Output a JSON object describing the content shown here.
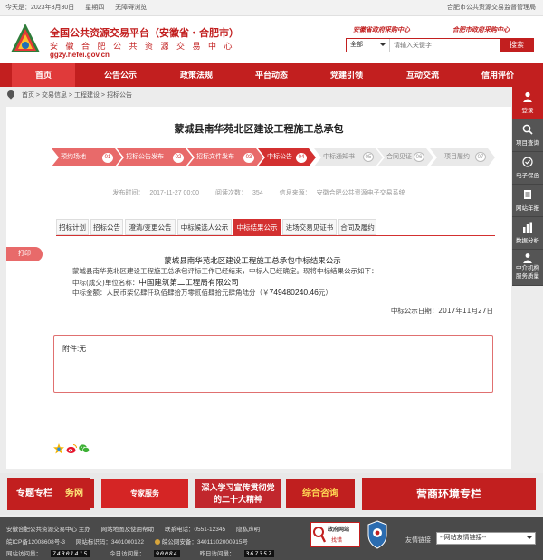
{
  "topbar": {
    "date": "今天是：2023年3月30日",
    "weekday": "星期四",
    "accessibility": "无障碍浏览",
    "right": "合肥市公共资源交易监督管理局"
  },
  "header": {
    "title": "全国公共资源交易平台（安徽省・合肥市）",
    "subtitle": "安 徽 合 肥 公 共 资 源 交 易 中 心",
    "domain": "ggzy.hefei.gov.cn",
    "slogan_left": "安徽省政府采购中心",
    "slogan_right": "合肥市政府采购中心",
    "search_scope": "全部",
    "search_placeholder": "请输入关键字",
    "search_button": "搜索"
  },
  "nav": [
    "首页",
    "公告公示",
    "政策法规",
    "平台动态",
    "党建引领",
    "互动交流",
    "信用评价"
  ],
  "breadcrumb": [
    "首页",
    "交易信息",
    "工程建设",
    "招标公告"
  ],
  "breadcrumb_sep": ">",
  "article": {
    "title": "蒙城县南华苑北区建设工程施工总承包",
    "steps": [
      {
        "label": "预约场地",
        "num": "01"
      },
      {
        "label": "招标公告发布",
        "num": "02"
      },
      {
        "label": "招标文件发布",
        "num": "03"
      },
      {
        "label": "中标公告",
        "num": "04"
      },
      {
        "label": "中标通知书",
        "num": "05"
      },
      {
        "label": "合同见证",
        "num": "06"
      },
      {
        "label": "项目履约",
        "num": "07"
      }
    ],
    "meta": {
      "time_label": "发布时间：",
      "time": "2017-11-27 00:00",
      "views_label": "阅读次数：",
      "views": "354",
      "source_label": "信息来源：",
      "source": "安徽合肥公共资源电子交易系统"
    },
    "tabs": [
      "招标计划",
      "招标公告",
      "澄清/变更公告",
      "中标候选人公示",
      "中标结果公示",
      "进场交易见证书",
      "合同及履约"
    ],
    "print": "打印",
    "notice_title": "蒙城县南华苑北区建设工程施工总承包中标结果公示",
    "notice_line1": "蒙城县南华苑北区建设工程施工总承包评标工作已经结束，中标人已经确定。现将中标结果公示如下：",
    "winner_label": "中标(成交)单位名称：",
    "winner": "中国建筑第二工程局有限公司",
    "amount_label": "中标金额：",
    "amount_text": "人民币柒亿肆仟玖佰肆拾万零贰佰肆拾元肆角陆分（￥",
    "amount": "749480240.46",
    "amount_suffix": "元）",
    "notice_date": "中标公示日期：2017年11月27日",
    "attachment": "附件:无"
  },
  "sidebar": [
    "登录",
    "项目查询",
    "电子保函",
    "网站年报",
    "数据分析",
    "中介机构服务质量"
  ],
  "banner": {
    "label": "专题专栏",
    "cards": [
      "务网",
      "专家服务",
      "深入学习宣传贯彻党的二十大精神",
      "综合咨询"
    ],
    "biz": "营商环境专栏"
  },
  "footer": {
    "host": "安徽合肥公共资源交易中心 主办",
    "map": "网站地图及使用帮助",
    "phone": "联系电话：0551-12345",
    "statement": "隐私声明",
    "icp": "皖ICP备12008608号-3",
    "site_code": "网站标识码：3401000122",
    "police": "皖公网安备：34011102000915号",
    "visits_label": "网站访问量：",
    "visits": "74301415",
    "today_label": "今日访问量：",
    "today": "90084",
    "yesterday_label": "昨日访问量：",
    "yesterday": "367357",
    "gov_site": "政府网站",
    "gov_fix": "找错",
    "links_label": "友情链接",
    "links_select": "--网站友情链接--"
  }
}
